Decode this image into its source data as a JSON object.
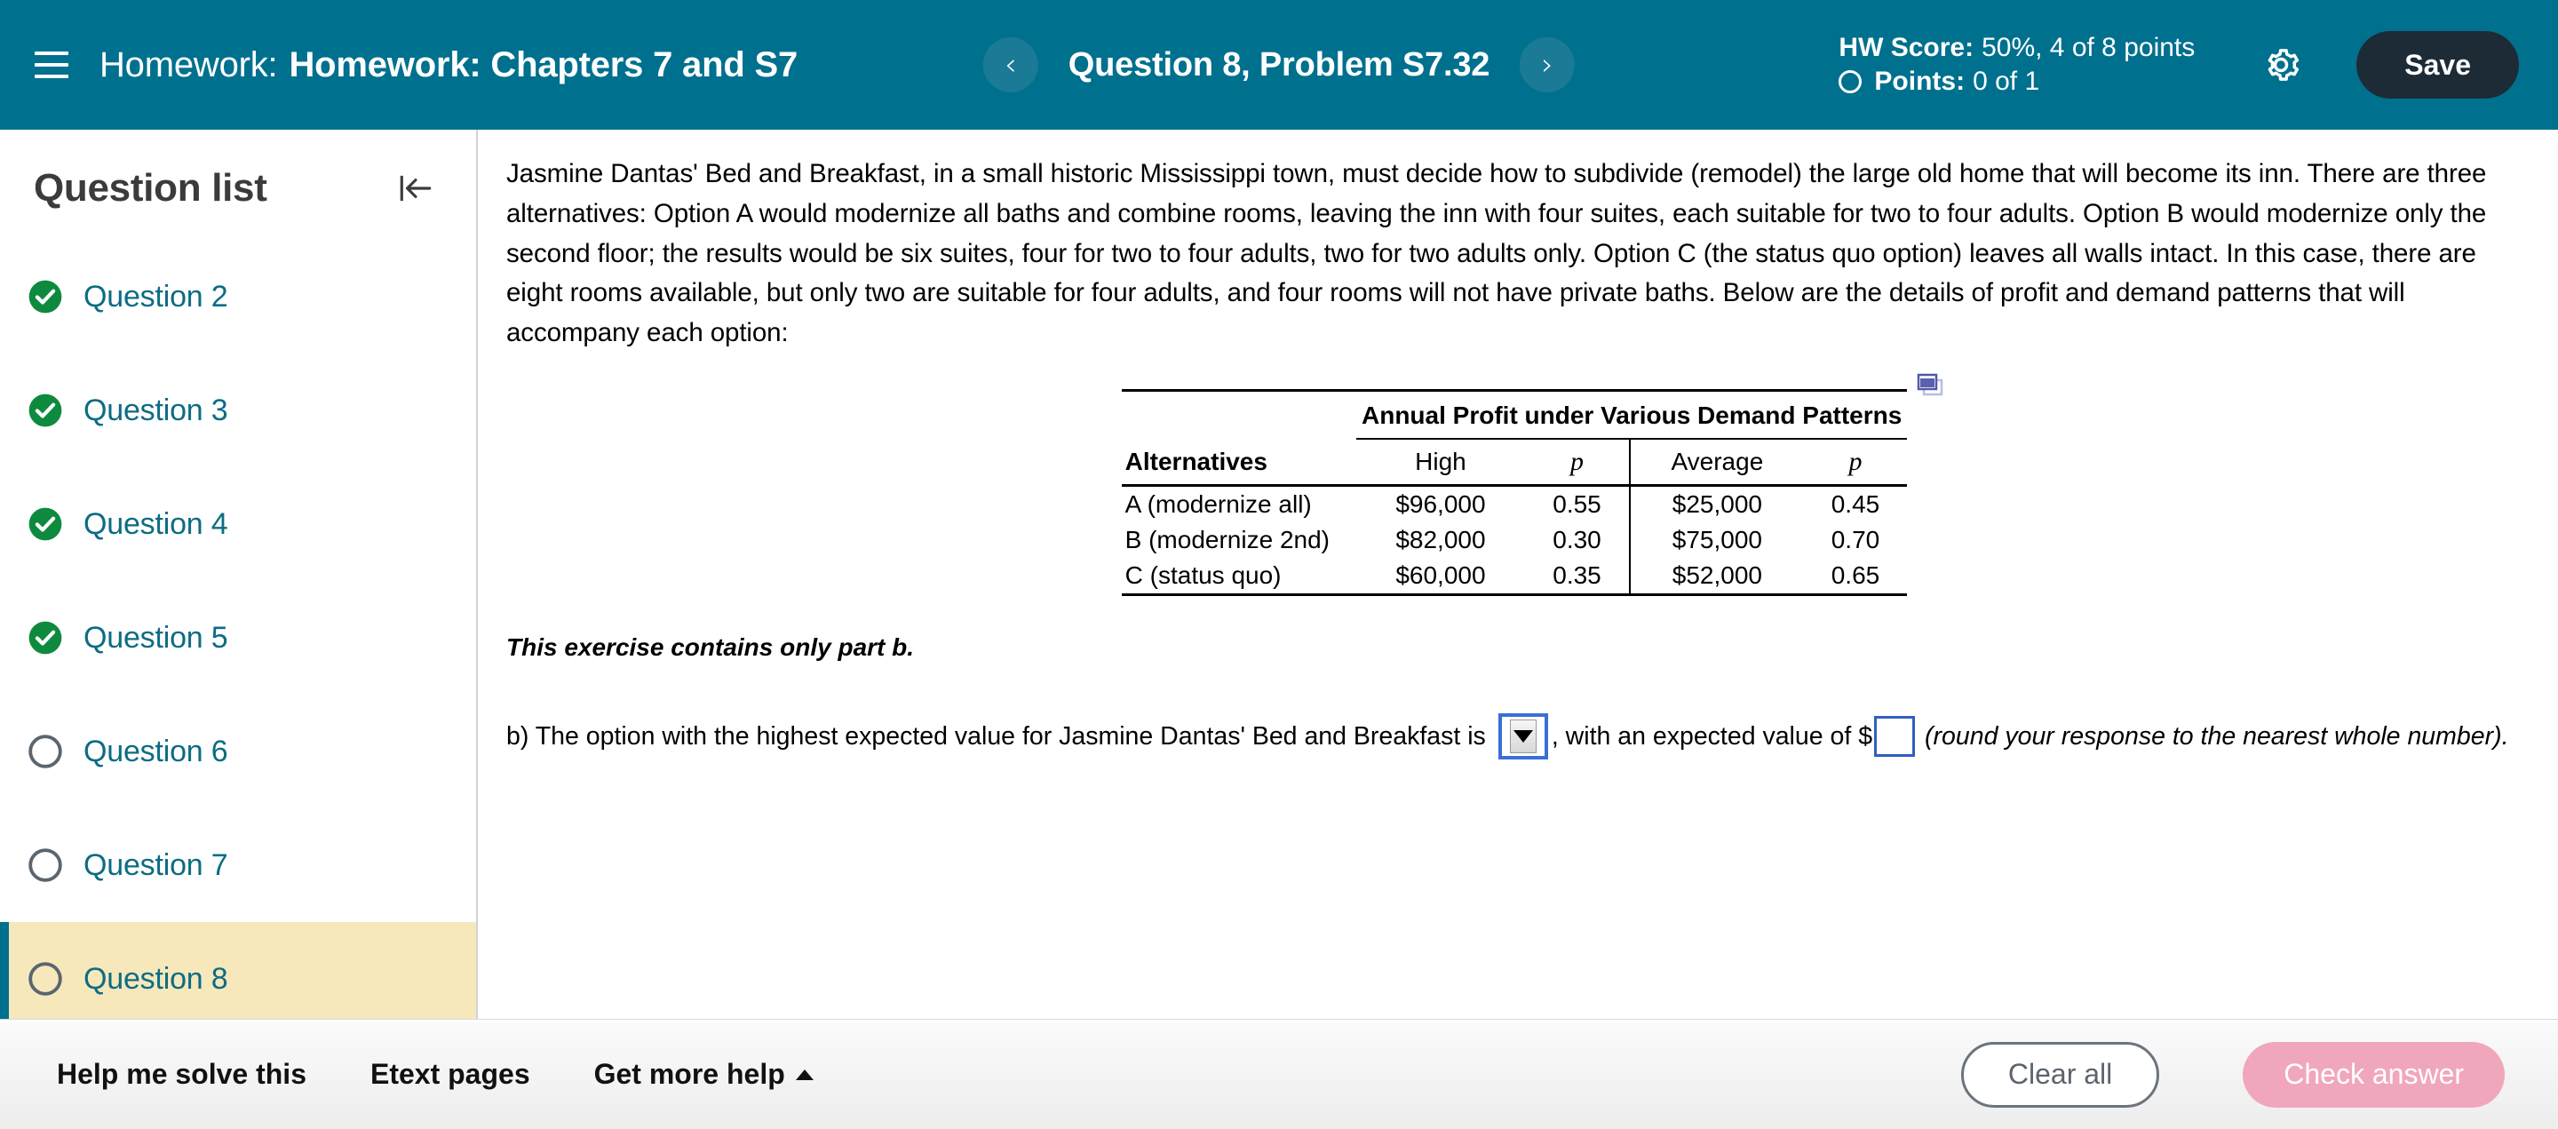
{
  "header": {
    "menu_icon": "hamburger-icon",
    "breadcrumb_label": "Homework:",
    "title": "Homework: Chapters 7 and S7",
    "prev_icon": "chevron-left-icon",
    "next_icon": "chevron-right-icon",
    "question_nav_title": "Question 8, Problem S7.32",
    "hw_score_label": "HW Score:",
    "hw_score_value": "50%, 4 of 8 points",
    "points_label": "Points:",
    "points_value": "0 of 1",
    "settings_icon": "gear-icon",
    "save_label": "Save",
    "bg_color": "#00708f",
    "save_bg_color": "#1d2b36"
  },
  "sidebar": {
    "title": "Question list",
    "collapse_icon": "collapse-left-icon",
    "items": [
      {
        "label": "Question 2",
        "status": "complete",
        "active": false
      },
      {
        "label": "Question 3",
        "status": "complete",
        "active": false
      },
      {
        "label": "Question 4",
        "status": "complete",
        "active": false
      },
      {
        "label": "Question 5",
        "status": "complete",
        "active": false
      },
      {
        "label": "Question 6",
        "status": "incomplete",
        "active": false
      },
      {
        "label": "Question 7",
        "status": "incomplete",
        "active": false
      },
      {
        "label": "Question 8",
        "status": "incomplete",
        "active": true
      }
    ],
    "complete_color": "#0e8a3e",
    "link_color": "#0d6c84",
    "active_bg_color": "#f6e8bb"
  },
  "main": {
    "prompt": "Jasmine Dantas' Bed and Breakfast, in a small historic Mississippi town, must decide how to subdivide (remodel) the large old home that will become its inn. There are three alternatives: Option A would modernize all baths and combine rooms, leaving the inn with four suites, each suitable for two to four adults. Option B would modernize only the second floor; the results would be six suites, four for two to four adults, two for two adults only. Option C (the status quo option) leaves all walls intact. In this case, there are eight rooms available, but only two are suitable for four adults, and four rooms will not have private baths. Below are the details of profit and demand patterns that will accompany each option:",
    "popout_icon": "popout-window-icon",
    "note": "This exercise contains only part b.",
    "part_b_prefix": "b) The option with the highest expected value for Jasmine Dantas' Bed and Breakfast is",
    "dropdown_value": "",
    "dropdown_icon": "dropdown-arrow-icon",
    "part_b_middle": ", with an expected value of $",
    "answer_value": "",
    "part_b_suffix": "(round your response to the nearest whole number)."
  },
  "chart_data": {
    "type": "table",
    "title": "Annual Profit under Various Demand Patterns",
    "group_header": "Annual Profit under Various Demand Patterns",
    "row_header": "Alternatives",
    "columns": [
      "Alternatives",
      "High",
      "p",
      "Average",
      "p"
    ],
    "rows": [
      {
        "alternative": "A (modernize all)",
        "high": "$96,000",
        "p_high": "0.55",
        "average": "$25,000",
        "p_avg": "0.45"
      },
      {
        "alternative": "B (modernize 2nd)",
        "high": "$82,000",
        "p_high": "0.30",
        "average": "$75,000",
        "p_avg": "0.70"
      },
      {
        "alternative": "C (status quo)",
        "high": "$60,000",
        "p_high": "0.35",
        "average": "$52,000",
        "p_avg": "0.65"
      }
    ]
  },
  "footer": {
    "help_solve": "Help me solve this",
    "etext_pages": "Etext pages",
    "get_more_help": "Get more help",
    "get_more_help_icon": "caret-up-icon",
    "clear_all": "Clear all",
    "check_answer": "Check answer",
    "check_bg_color": "#f1a7bb"
  }
}
